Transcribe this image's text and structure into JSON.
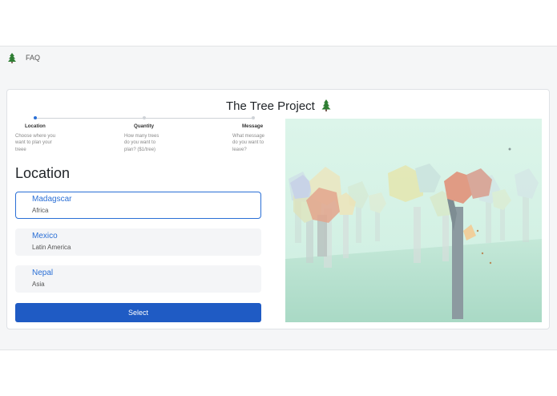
{
  "nav": {
    "logo_icon": "tree-icon",
    "faq_label": "FAQ"
  },
  "card": {
    "title": "The Tree Project",
    "title_icon": "tree-icon"
  },
  "steps": [
    {
      "title": "Location",
      "description": "Choose where you want to plan your treee",
      "active": true
    },
    {
      "title": "Quantity",
      "description": "How many trees do you want to plan? ($1/tree)",
      "active": false
    },
    {
      "title": "Message",
      "description": "What message do you want to leave?",
      "active": false
    }
  ],
  "section_title": "Location",
  "locations": [
    {
      "name": "Madagscar",
      "region": "Africa",
      "selected": true
    },
    {
      "name": "Mexico",
      "region": "Latin America",
      "selected": false
    },
    {
      "name": "Nepal",
      "region": "Asia",
      "selected": false
    }
  ],
  "select_button": "Select",
  "colors": {
    "accent": "#2a6fd6",
    "button": "#1f5bc4",
    "scene_bg": "#d4f0e4"
  }
}
